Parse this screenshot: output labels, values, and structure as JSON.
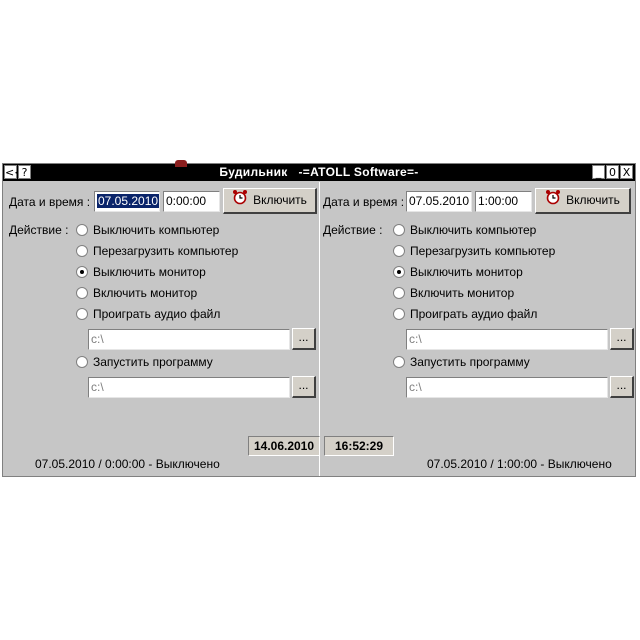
{
  "window": {
    "title": "Будильник   -=ATOLL Software=-",
    "btn_back": "<<",
    "btn_help": "?",
    "btn_min": "_",
    "btn_max": "0",
    "btn_close": "X"
  },
  "left": {
    "date_label": "Дата и время :",
    "date": "07.05.2010",
    "time": "0:00:00",
    "enable_label": "Включить",
    "action_label": "Действие :",
    "options": [
      {
        "label": "Выключить компьютер",
        "checked": false
      },
      {
        "label": "Перезагрузить компьютер",
        "checked": false
      },
      {
        "label": "Выключить монитор",
        "checked": true
      },
      {
        "label": "Включить монитор",
        "checked": false
      },
      {
        "label": "Проиграть аудио файл",
        "checked": false
      },
      {
        "label": "Запустить программу",
        "checked": false
      }
    ],
    "audio_path": "c:\\",
    "program_path": "c:\\",
    "browse_label": "...",
    "status": "07.05.2010 / 0:00:00 - Выключено"
  },
  "right": {
    "date_label": "Дата и время :",
    "date": "07.05.2010",
    "time": "1:00:00",
    "enable_label": "Включить",
    "action_label": "Действие :",
    "options": [
      {
        "label": "Выключить компьютер",
        "checked": false
      },
      {
        "label": "Перезагрузить компьютер",
        "checked": false
      },
      {
        "label": "Выключить монитор",
        "checked": true
      },
      {
        "label": "Включить монитор",
        "checked": false
      },
      {
        "label": "Проиграть аудио файл",
        "checked": false
      },
      {
        "label": "Запустить программу",
        "checked": false
      }
    ],
    "audio_path": "c:\\",
    "program_path": "c:\\",
    "browse_label": "...",
    "status": "07.05.2010 / 1:00:00 - Выключено"
  },
  "clock": {
    "date": "14.06.2010",
    "time": "16:52:29"
  },
  "colors": {
    "window_bg": "#c6c6c6",
    "titlebar": "#000000",
    "selection": "#0a246a"
  }
}
